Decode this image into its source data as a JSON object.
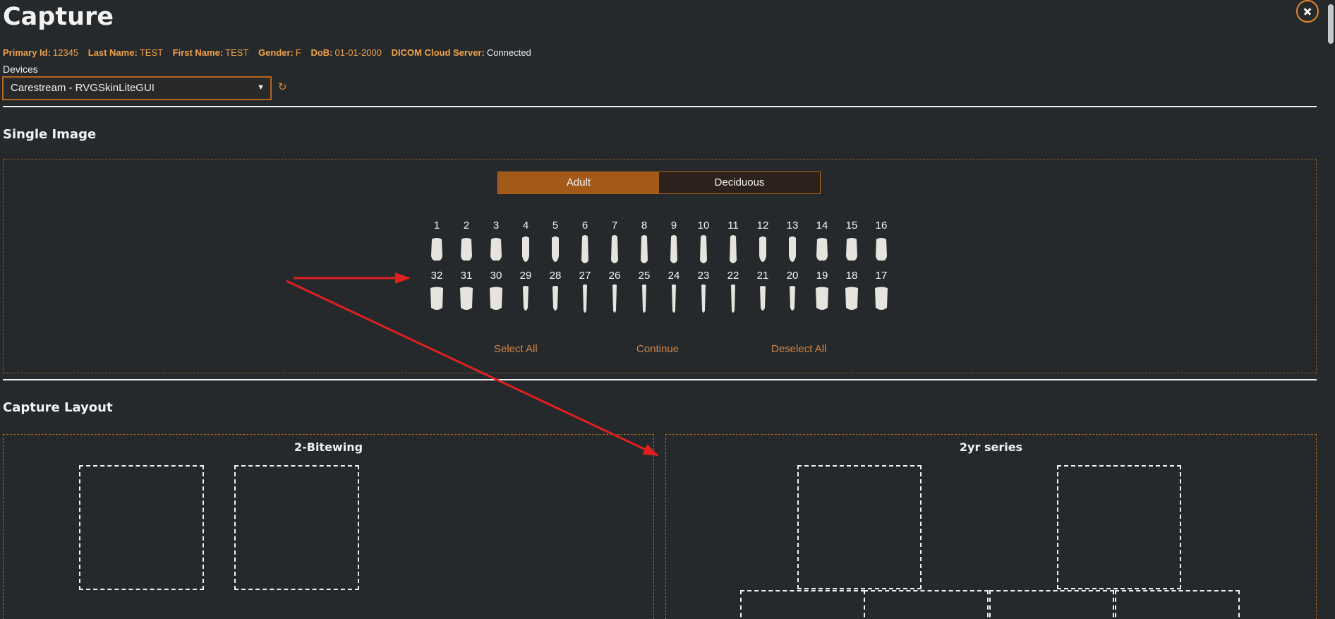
{
  "app": {
    "title": "Capture"
  },
  "patient": [
    {
      "key": "Primary Id:",
      "value": "12345"
    },
    {
      "key": "Last Name:",
      "value": "TEST"
    },
    {
      "key": "First Name:",
      "value": "TEST"
    },
    {
      "key": "Gender:",
      "value": "F"
    },
    {
      "key": "DoB:",
      "value": "01-01-2000"
    },
    {
      "key": "DICOM Cloud Server:",
      "value": "Connected"
    }
  ],
  "devices": {
    "label": "Devices",
    "selected": "Carestream - RVGSkinLiteGUI"
  },
  "single_image": {
    "title": "Single Image",
    "tabs": [
      "Adult",
      "Deciduous"
    ],
    "upper_teeth": [
      "1",
      "2",
      "3",
      "4",
      "5",
      "6",
      "7",
      "8",
      "9",
      "10",
      "11",
      "12",
      "13",
      "14",
      "15",
      "16"
    ],
    "lower_teeth": [
      "32",
      "31",
      "30",
      "29",
      "28",
      "27",
      "26",
      "25",
      "24",
      "23",
      "22",
      "21",
      "20",
      "19",
      "18",
      "17"
    ],
    "select_all": "Select All",
    "continue": "Continue",
    "deselect_all": "Deselect All"
  },
  "capture_layout": {
    "title": "Capture Layout",
    "layouts": [
      "2-Bitewing",
      "2yr series"
    ]
  },
  "colors": {
    "accent": "#b3661c",
    "active_tab": "#a35a18",
    "arrow": "#e02020"
  }
}
